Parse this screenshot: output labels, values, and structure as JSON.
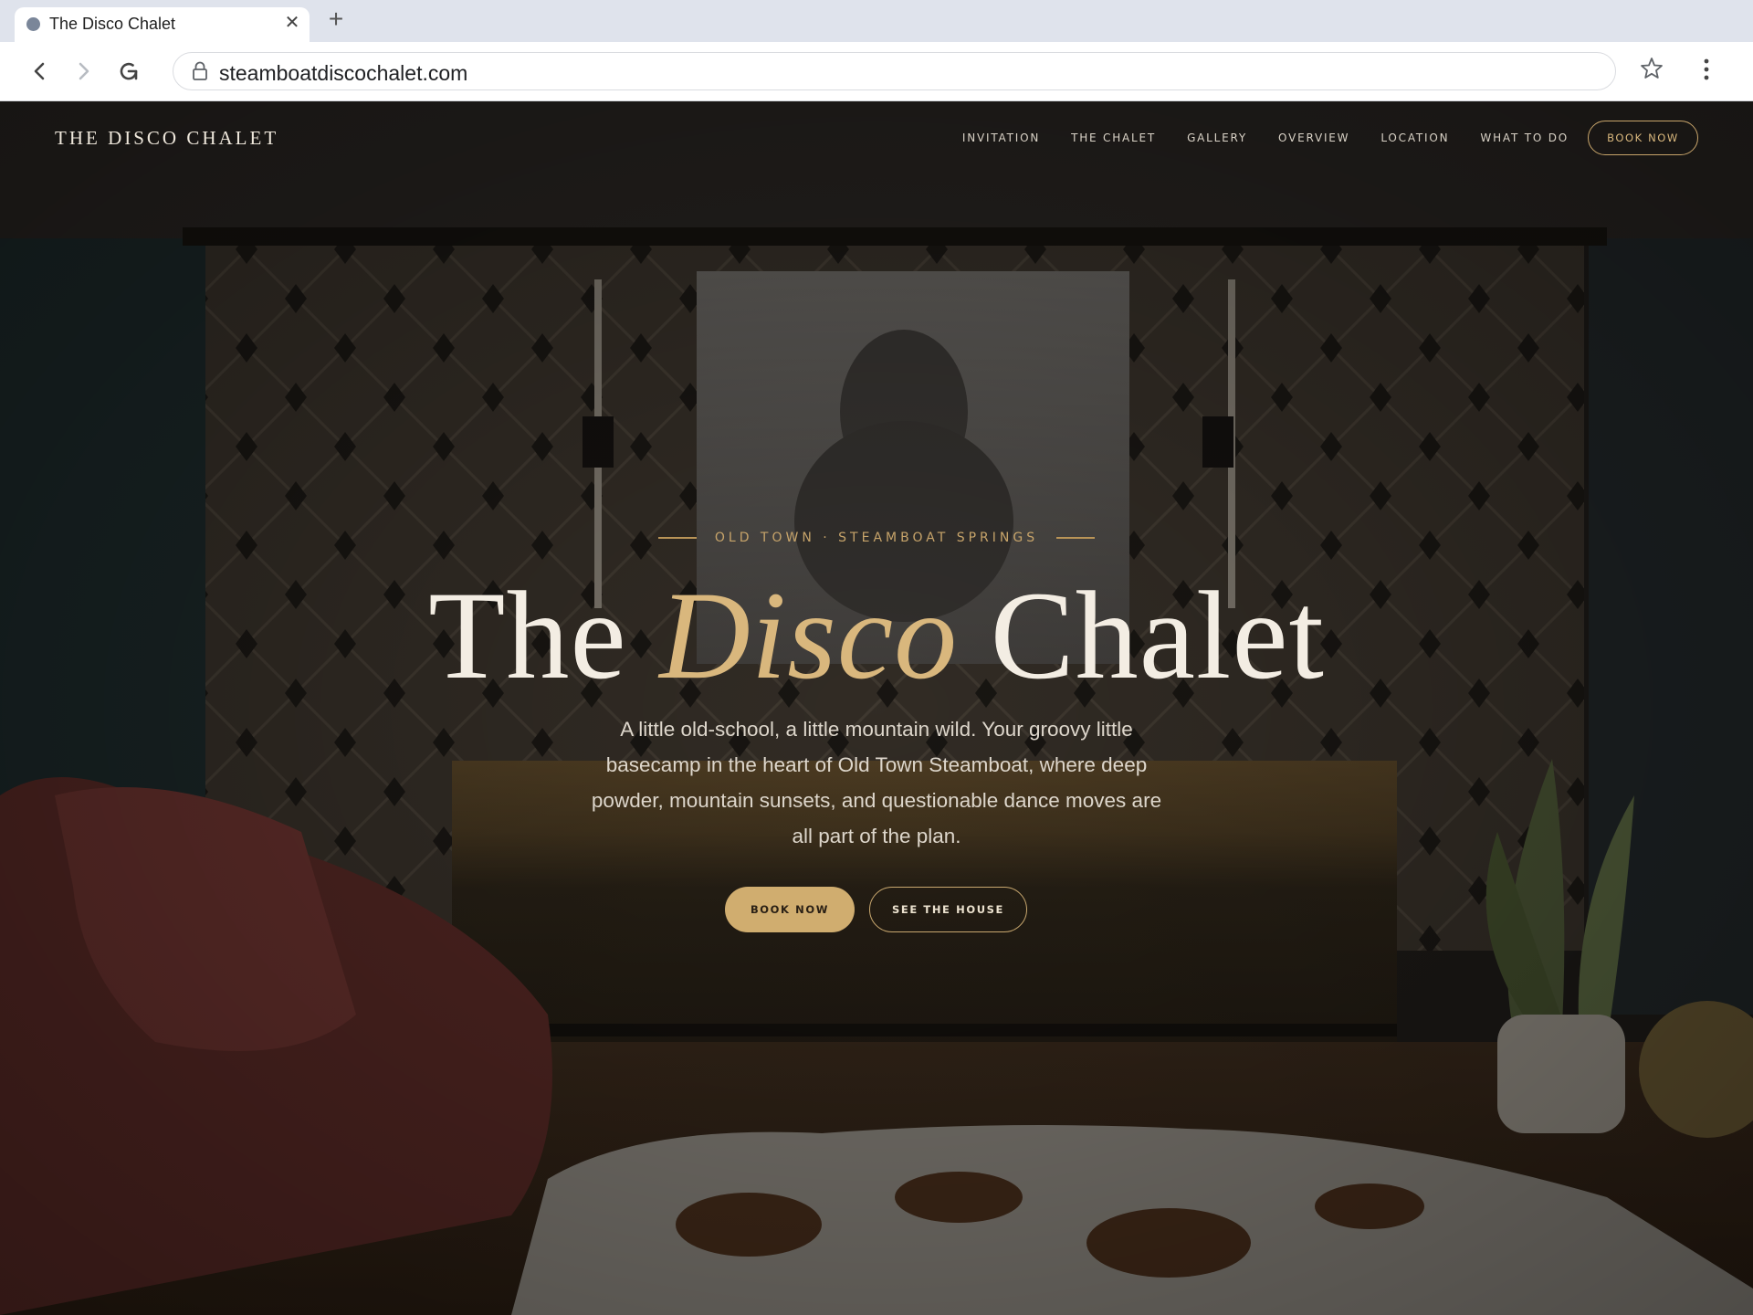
{
  "browser": {
    "tab": {
      "title": "The Disco Chalet",
      "favicon": "globe-icon"
    },
    "url": "steamboatdiscochalet.com",
    "icons": [
      "back-icon",
      "forward-icon",
      "reload-icon",
      "lock-icon",
      "star-icon",
      "menu-icon"
    ]
  },
  "site": {
    "brand": "THE DISCO CHALET",
    "nav": [
      "INVITATION",
      "THE CHALET",
      "GALLERY",
      "OVERVIEW",
      "LOCATION",
      "WHAT TO DO"
    ],
    "nav_cta": "BOOK NOW",
    "accent_color": "#d0ad6f"
  },
  "hero": {
    "eyebrow": "OLD TOWN · STEAMBOAT SPRINGS",
    "title_before": "The ",
    "title_accent": "Disco",
    "title_after": " Chalet",
    "description": "A little old-school, a little mountain wild. Your groovy little basecamp in the heart of Old Town Steamboat, where deep powder, mountain sunsets, and questionable dance moves are all part of the plan.",
    "primary_cta": "BOOK NOW",
    "secondary_cta": "SEE THE HOUSE"
  }
}
